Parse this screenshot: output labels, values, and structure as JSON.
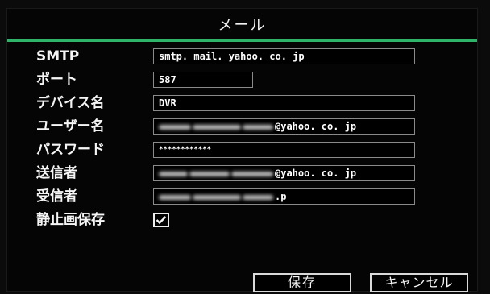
{
  "window": {
    "title": "メール"
  },
  "form": {
    "smtp": {
      "label": "SMTP",
      "value": "smtp. mail. yahoo. co. jp"
    },
    "port": {
      "label": "ポート",
      "value": "587"
    },
    "device_name": {
      "label": "デバイス名",
      "value": "DVR"
    },
    "user_name": {
      "label": "ユーザー名",
      "value_suffix": "@yahoo. co. jp"
    },
    "password": {
      "label": "パスワード",
      "value": "************"
    },
    "sender": {
      "label": "送信者",
      "value_suffix": "@yahoo. co. jp"
    },
    "recipient": {
      "label": "受信者",
      "value_suffix": ".p"
    },
    "save_snapshot": {
      "label": "静止画保存",
      "checked": true
    }
  },
  "buttons": {
    "save": "保存",
    "cancel": "キャンセル"
  },
  "colors": {
    "accent_line": "#2fb56a",
    "background": "#050505"
  }
}
